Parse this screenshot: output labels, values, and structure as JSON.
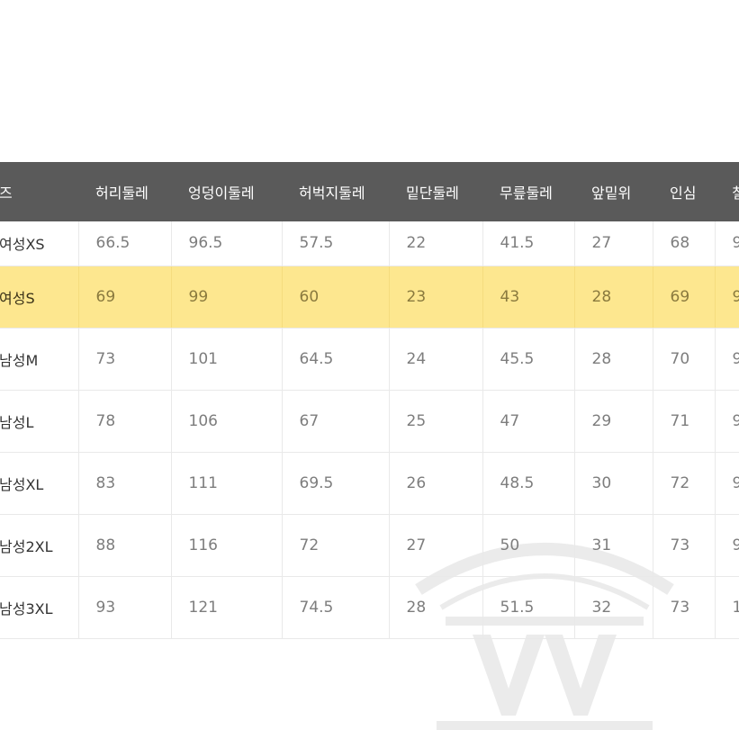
{
  "colors": {
    "header_bg": "#5a5a5a",
    "highlight": "#fde78f"
  },
  "table": {
    "headers": [
      "즈",
      "허리둘레",
      "엉덩이둘레",
      "허벅지둘레",
      "밑단둘레",
      "무릎둘레",
      "앞밑위",
      "인심",
      "칠"
    ],
    "rows": [
      [
        "여성XS",
        "66.5",
        "96.5",
        "57.5",
        "22",
        "41.5",
        "27",
        "68",
        "9"
      ],
      [
        "여성S",
        "69",
        "99",
        "60",
        "23",
        "43",
        "28",
        "69",
        "9"
      ],
      [
        "남성M",
        "73",
        "101",
        "64.5",
        "24",
        "45.5",
        "28",
        "70",
        "9"
      ],
      [
        "남성L",
        "78",
        "106",
        "67",
        "25",
        "47",
        "29",
        "71",
        "9"
      ],
      [
        "남성XL",
        "83",
        "111",
        "69.5",
        "26",
        "48.5",
        "30",
        "72",
        "9"
      ],
      [
        "남성2XL",
        "88",
        "116",
        "72",
        "27",
        "50",
        "31",
        "73",
        "9"
      ],
      [
        "남성3XL",
        "93",
        "121",
        "74.5",
        "28",
        "51.5",
        "32",
        "73",
        "1"
      ]
    ],
    "highlighted_row": 1
  }
}
